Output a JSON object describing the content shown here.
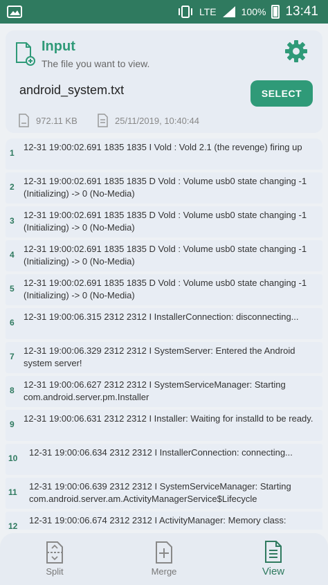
{
  "status_bar": {
    "network_label": "LTE",
    "battery_text": "100%",
    "time": "13:41"
  },
  "input_card": {
    "title": "Input",
    "subtitle": "The file you want to view.",
    "file_name": "android_system.txt",
    "select_label": "SELECT",
    "file_size": "972.11 KB",
    "file_date": "25/11/2019, 10:40:44"
  },
  "log": [
    {
      "num": "1",
      "text": "12-31 19:00:02.691  1835  1835 I Vold      : Vold 2.1 (the revenge) firing up"
    },
    {
      "num": "2",
      "text": "12-31 19:00:02.691  1835  1835 D Vold      : Volume usb0 state changing -1 (Initializing) -> 0 (No-Media)"
    },
    {
      "num": "3",
      "text": "12-31 19:00:02.691  1835  1835 D Vold      : Volume usb0 state changing -1 (Initializing) -> 0 (No-Media)"
    },
    {
      "num": "4",
      "text": "12-31 19:00:02.691  1835  1835 D Vold      : Volume usb0 state changing -1 (Initializing) -> 0 (No-Media)"
    },
    {
      "num": "5",
      "text": "12-31 19:00:02.691  1835  1835 D Vold      : Volume usb0 state changing -1 (Initializing) -> 0 (No-Media)"
    },
    {
      "num": "6",
      "text": "12-31 19:00:06.315  2312  2312 I InstallerConnection: disconnecting..."
    },
    {
      "num": "7",
      "text": "12-31 19:00:06.329  2312  2312 I SystemServer: Entered the Android system server!"
    },
    {
      "num": "8",
      "text": "12-31 19:00:06.627  2312  2312 I SystemServiceManager: Starting com.android.server.pm.Installer"
    },
    {
      "num": "9",
      "text": "12-31 19:00:06.631  2312  2312 I Installer: Waiting for installd to be ready."
    },
    {
      "num": "10",
      "text": "12-31 19:00:06.634  2312  2312 I InstallerConnection: connecting..."
    },
    {
      "num": "11",
      "text": "12-31 19:00:06.639  2312  2312 I SystemServiceManager: Starting com.android.server.am.ActivityManagerService$Lifecycle"
    },
    {
      "num": "12",
      "text": "12-31 19:00:06.674  2312  2312 I ActivityManager: Memory class:"
    }
  ],
  "bottom_nav": {
    "split": "Split",
    "merge": "Merge",
    "view": "View"
  },
  "colors": {
    "accent": "#2f9a78",
    "status_bar": "#2f7a5f"
  }
}
